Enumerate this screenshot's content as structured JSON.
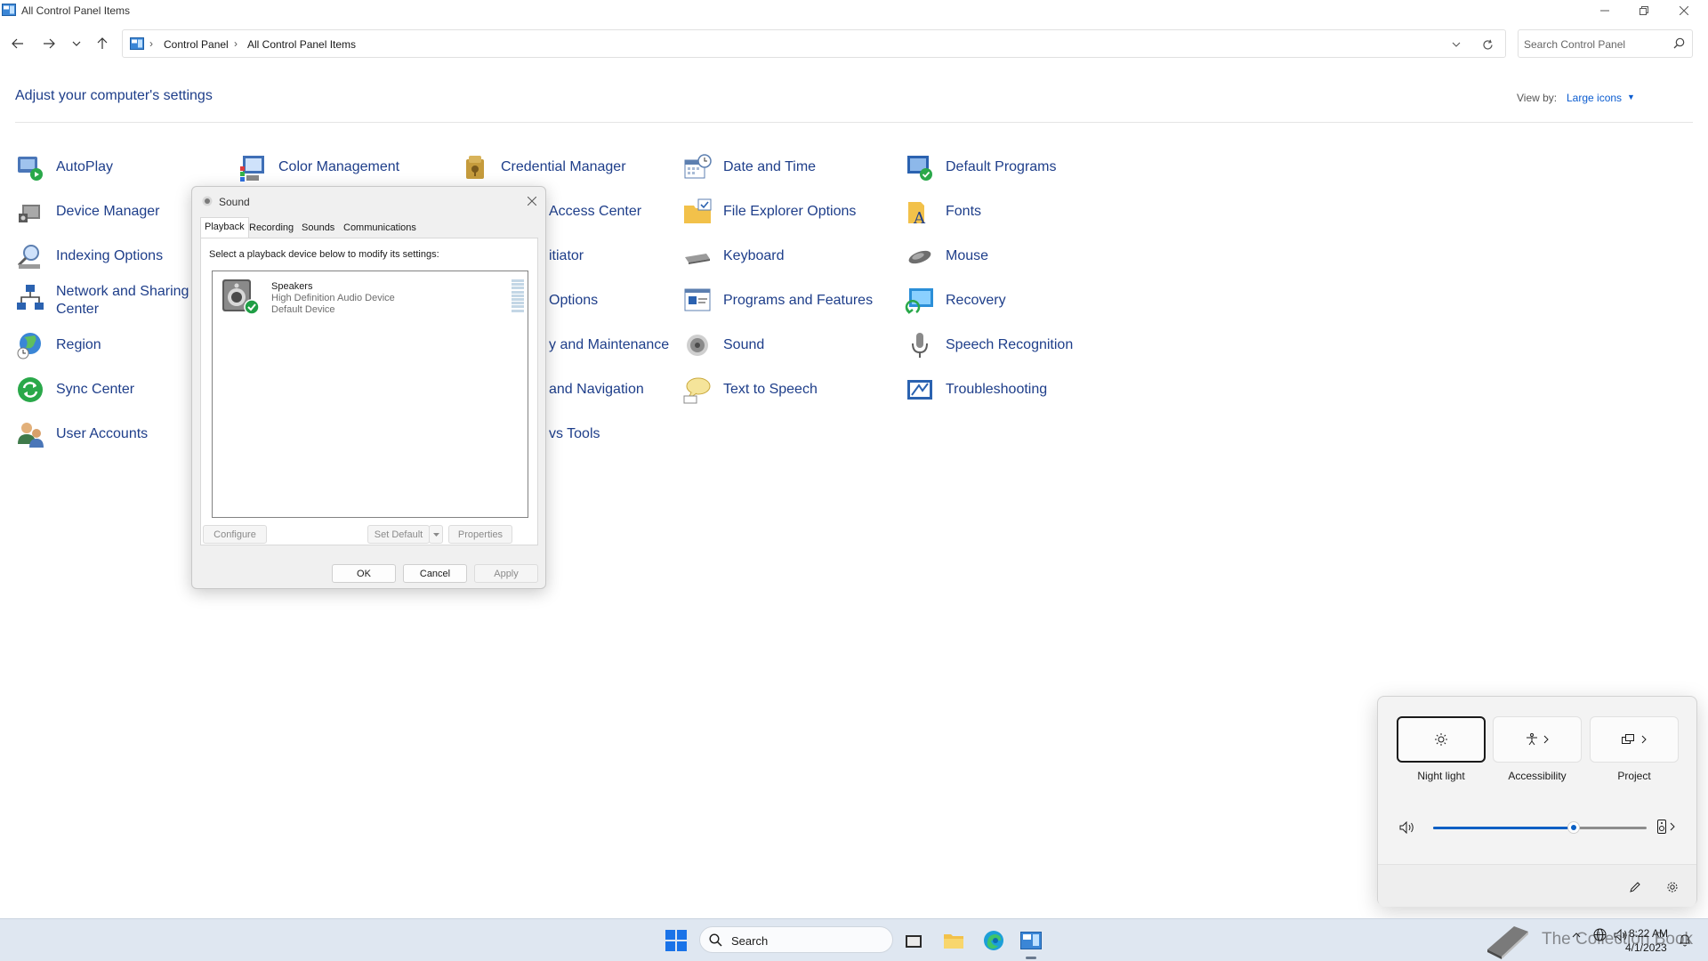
{
  "window": {
    "title": "All Control Panel Items"
  },
  "address": {
    "crumbs": [
      "Control Panel",
      "All Control Panel Items"
    ],
    "search_placeholder": "Search Control Panel"
  },
  "header": {
    "title": "Adjust your computer's settings",
    "view_by_label": "View by:",
    "view_by_value": "Large icons"
  },
  "items": [
    "AutoPlay",
    "Color Management",
    "Credential Manager",
    "Date and Time",
    "Default Programs",
    "Device Manager",
    "Access Center",
    "File Explorer Options",
    "Fonts",
    "Indexing Options",
    "itiator",
    "Keyboard",
    "Mouse",
    "Network and Sharing",
    "Center",
    "Options",
    "Programs and Features",
    "Recovery",
    "Region",
    "y and Maintenance",
    "Sound",
    "Speech Recognition",
    "Sync Center",
    "and Navigation",
    "Text to Speech",
    "Troubleshooting",
    "User Accounts",
    "vs Tools"
  ],
  "sound_dialog": {
    "title": "Sound",
    "tabs": [
      "Playback",
      "Recording",
      "Sounds",
      "Communications"
    ],
    "instructions": "Select a playback device below to modify its settings:",
    "device": {
      "name": "Speakers",
      "description": "High Definition Audio Device",
      "status": "Default Device"
    },
    "buttons": {
      "configure": "Configure",
      "set_default": "Set Default",
      "properties": "Properties",
      "ok": "OK",
      "cancel": "Cancel",
      "apply": "Apply"
    }
  },
  "quick_settings": {
    "tiles": [
      "Night light",
      "Accessibility",
      "Project"
    ],
    "volume_fraction": 0.66
  },
  "taskbar": {
    "search_label": "Search",
    "time": "8:22 AM",
    "date": "4/1/2023",
    "watermark": "The Collection Book"
  },
  "colors": {
    "link": "#1e3e8a",
    "accent": "#0a5fc4",
    "taskbar": "#dfe7f1"
  }
}
